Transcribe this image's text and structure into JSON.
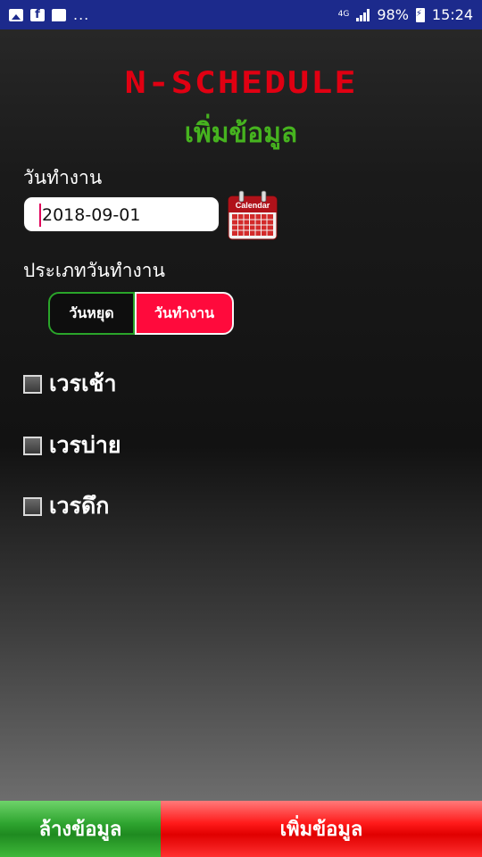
{
  "status_bar": {
    "dots": "...",
    "network": "4G",
    "battery_percent": "98%",
    "time": "15:24",
    "left_icons": [
      "image-icon",
      "facebook-icon",
      "message-icon"
    ]
  },
  "header": {
    "app_title": "N-SCHEDULE",
    "page_title": "เพิ่มข้อมูล"
  },
  "form": {
    "work_date_label": "วันทำงาน",
    "work_date_value": "2018-09-01",
    "calendar_icon_text": "Calendar",
    "day_type_label": "ประเภทวันทำงาน",
    "day_type_options": [
      "วันหยุด",
      "วันทำงาน"
    ],
    "day_type_selected": "วันทำงาน",
    "shifts": [
      {
        "label": "เวรเช้า",
        "checked": false
      },
      {
        "label": "เวรบ่าย",
        "checked": false
      },
      {
        "label": "เวรดึก",
        "checked": false
      }
    ]
  },
  "actions": {
    "clear_label": "ล้างข้อมูล",
    "add_label": "เพิ่มข้อมูล"
  },
  "colors": {
    "status_bar": "#1c2a8c",
    "app_title": "#e00012",
    "page_title": "#46b31f",
    "selected_segment": "#ff0a3c",
    "clear_button": "#2fa530",
    "add_button": "#ff1a1a"
  }
}
